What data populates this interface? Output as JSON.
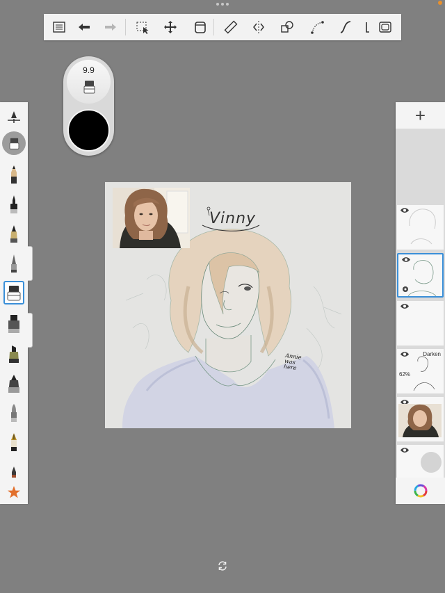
{
  "toolbar": {
    "items": [
      {
        "name": "layers-list-icon"
      },
      {
        "name": "undo-icon"
      },
      {
        "name": "redo-icon"
      },
      {
        "name": "selection-icon"
      },
      {
        "name": "transform-icon"
      },
      {
        "name": "fill-bucket-icon"
      },
      {
        "name": "ruler-icon"
      },
      {
        "name": "symmetry-icon"
      },
      {
        "name": "shapes-icon"
      },
      {
        "name": "curve-icon"
      },
      {
        "name": "stroke-icon"
      },
      {
        "name": "perspective-icon"
      },
      {
        "name": "fullscreen-icon"
      }
    ]
  },
  "brush_puck": {
    "size_label": "9.9",
    "color": "#000000"
  },
  "brushes": [
    {
      "name": "pencil",
      "selected": false
    },
    {
      "name": "ink-pen",
      "selected": false
    },
    {
      "name": "marker",
      "selected": false
    },
    {
      "name": "airbrush",
      "selected": false
    },
    {
      "name": "eraser",
      "selected": true
    },
    {
      "name": "paint-brush",
      "selected": false
    },
    {
      "name": "chisel-marker",
      "selected": false
    },
    {
      "name": "large-marker",
      "selected": false
    },
    {
      "name": "smudge",
      "selected": false
    },
    {
      "name": "fountain-pen",
      "selected": false
    },
    {
      "name": "dropper",
      "selected": false
    },
    {
      "name": "favorite-star",
      "selected": false
    }
  ],
  "canvas": {
    "title_text": "Vinny",
    "signature_text": "Annie was here",
    "accent_skin": "#e0c6a8",
    "line_color": "#7a9a8a"
  },
  "layers": [
    {
      "name": "layer-sketch-top",
      "selected": false,
      "blend": "",
      "opacity": ""
    },
    {
      "name": "layer-line-art",
      "selected": true,
      "blend": "",
      "opacity": ""
    },
    {
      "name": "layer-empty",
      "selected": false,
      "blend": "",
      "opacity": ""
    },
    {
      "name": "layer-darken",
      "selected": false,
      "blend": "Darken",
      "opacity": "62%"
    },
    {
      "name": "layer-photo",
      "selected": false,
      "blend": "",
      "opacity": ""
    },
    {
      "name": "layer-background",
      "selected": false,
      "blend": "",
      "opacity": ""
    }
  ],
  "layer_panel": {
    "add_label": "+"
  }
}
